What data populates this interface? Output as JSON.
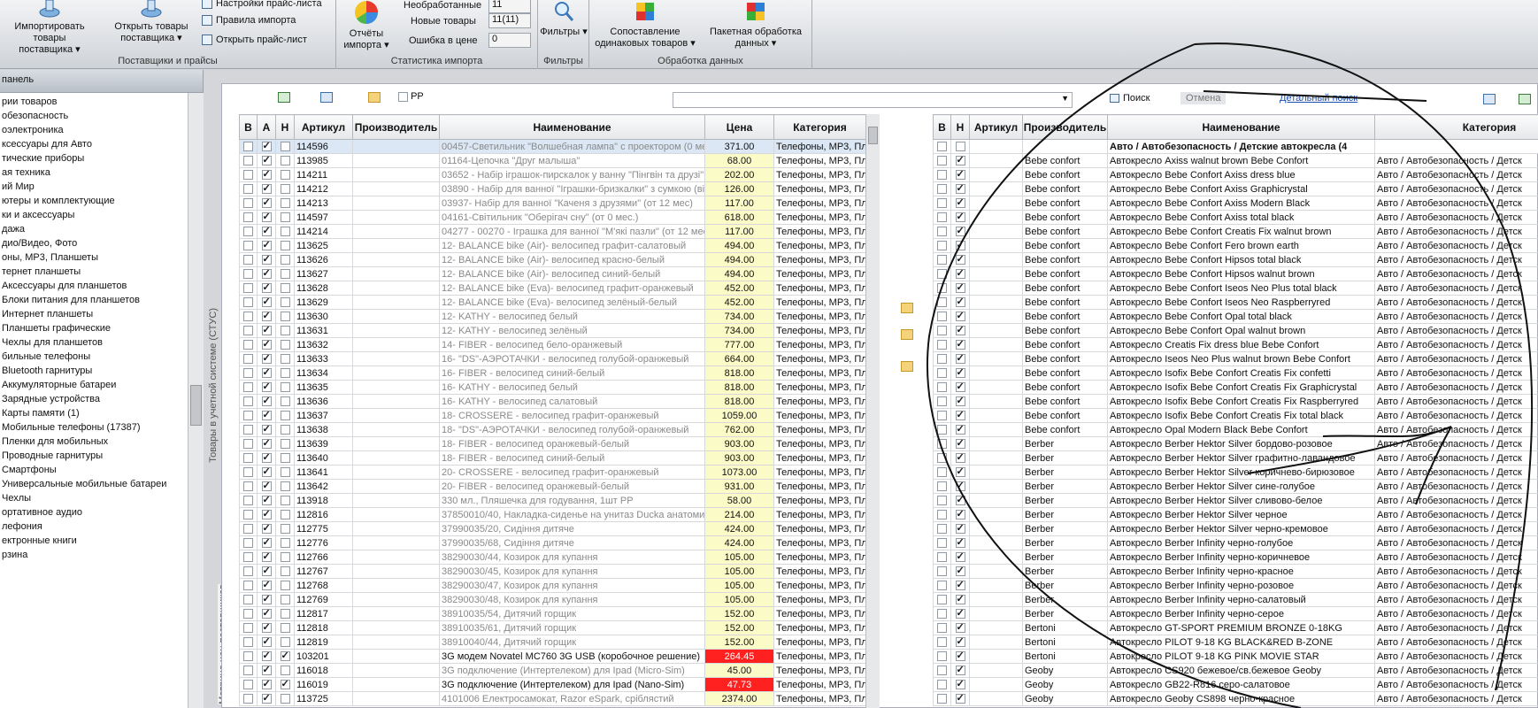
{
  "ribbon": {
    "suppliers": {
      "import_label": "Импортировать товары поставщика",
      "open_label": "Открыть товары поставщика",
      "settings_label": "Настройки прайс-листа",
      "rules_label": "Правила импорта",
      "open_price_label": "Открыть прайс-лист",
      "group_label": "Поставщики и прайсы"
    },
    "stats": {
      "reports_label": "Отчёты импорта",
      "unprocessed_label": "Необработанные",
      "unprocessed_value": "11",
      "new_label": "Новые товары",
      "new_value": "11(11)",
      "error_label": "Ошибка в цене",
      "error_value": "0",
      "group_label": "Статистика импорта"
    },
    "filters": {
      "label": "Фильтры",
      "group_label": "Фильтры"
    },
    "processing": {
      "match_label": "Сопоставление одинаковых товаров",
      "batch_label": "Пакетная обработка данных",
      "group_label": "Обработка данных"
    }
  },
  "left_panel": {
    "title": "панель",
    "tree_title": "рии товаров",
    "items": [
      "обезопасность",
      "оэлектроника",
      "ксессуары для Авто",
      "тические приборы",
      "ая техника",
      "ий Мир",
      "ютеры и комплектующие",
      "ки и аксессуары",
      "дажа",
      "дио/Видео, Фото",
      "оны, МР3, Планшеты",
      "тернет планшеты",
      "Аксессуары для планшетов",
      "Блоки питания для планшетов",
      "Интернет планшеты",
      "Планшеты графические",
      "Чехлы для планшетов",
      "бильные телефоны",
      "Bluetooth гарнитуры",
      "Аккумуляторные батареи",
      "Зарядные устройства",
      "Карты памяти (1)",
      "Мобильные телефоны (17387)",
      "Пленки для мобильных",
      "Проводные гарнитуры",
      "Смартфоны",
      "Универсальные мобильные батареи",
      "Чехлы",
      "ортативное аудио",
      "лефония",
      "ектронные книги",
      "рзина"
    ],
    "vertical_tab_1": "Товары в учетной системе (СТУС)",
    "vertical_tab_2": "Матрица цен поставщиков"
  },
  "toolbar": {
    "pp_label": "РР",
    "search_button": "Поиск",
    "cancel_button": "Отмена",
    "advanced_search": "Детальный поиск"
  },
  "left_grid": {
    "headers": [
      "В",
      "А",
      "Н",
      "Артикул",
      "Производитель",
      "Наименование",
      "Цена",
      "Категория"
    ],
    "rows": [
      {
        "v": false,
        "a": true,
        "n": false,
        "art": "114596",
        "name": "00457-Светильник \"Волшебная лампа\" с проектором (0 мес",
        "price": "371.00",
        "cat": "Телефоны, МР3, Пл",
        "sel": true
      },
      {
        "v": false,
        "a": true,
        "n": false,
        "art": "113985",
        "name": "01164-Цепочка \"Друг малыша\"",
        "price": "68.00",
        "cat": "Телефоны, МР3, Пл"
      },
      {
        "v": false,
        "a": true,
        "n": false,
        "art": "114211",
        "name": "03652 - Набір іграшок-пирскалок у ванну \"Пінгвін та друзі\"",
        "price": "202.00",
        "cat": "Телефоны, МР3, Пл"
      },
      {
        "v": false,
        "a": true,
        "n": false,
        "art": "114212",
        "name": "03890 - Набір для ванної \"Іграшки-бризкалки\" з сумкою (від",
        "price": "126.00",
        "cat": "Телефоны, МР3, Пл"
      },
      {
        "v": false,
        "a": true,
        "n": false,
        "art": "114213",
        "name": "03937- Набір для ванної \"Каченя з друзями\" (от 12 мес)",
        "price": "117.00",
        "cat": "Телефоны, МР3, Пл"
      },
      {
        "v": false,
        "a": true,
        "n": false,
        "art": "114597",
        "name": "04161-Світильник \"Оберігач сну\" (от 0 мес.)",
        "price": "618.00",
        "cat": "Телефоны, МР3, Пл"
      },
      {
        "v": false,
        "a": true,
        "n": false,
        "art": "114214",
        "name": "04277 - 00270 - Іграшка для ванної \"М'які пазли\" (от 12 мес",
        "price": "117.00",
        "cat": "Телефоны, МР3, Пл"
      },
      {
        "v": false,
        "a": true,
        "n": false,
        "art": "113625",
        "name": "12- BALANCE bike (Air)- велосипед графит-салатовый",
        "price": "494.00",
        "cat": "Телефоны, МР3, Пл"
      },
      {
        "v": false,
        "a": true,
        "n": false,
        "art": "113626",
        "name": "12- BALANCE bike (Air)- велосипед красно-белый",
        "price": "494.00",
        "cat": "Телефоны, МР3, Пл"
      },
      {
        "v": false,
        "a": true,
        "n": false,
        "art": "113627",
        "name": "12- BALANCE bike (Air)- велосипед синий-белый",
        "price": "494.00",
        "cat": "Телефоны, МР3, Пл"
      },
      {
        "v": false,
        "a": true,
        "n": false,
        "art": "113628",
        "name": "12- BALANCE bike (Eva)- велосипед графит-оранжевый",
        "price": "452.00",
        "cat": "Телефоны, МР3, Пл"
      },
      {
        "v": false,
        "a": true,
        "n": false,
        "art": "113629",
        "name": "12- BALANCE bike (Eva)- велосипед зелёный-белый",
        "price": "452.00",
        "cat": "Телефоны, МР3, Пл"
      },
      {
        "v": false,
        "a": true,
        "n": false,
        "art": "113630",
        "name": "12- KATHY - велосипед белый",
        "price": "734.00",
        "cat": "Телефоны, МР3, Пл"
      },
      {
        "v": false,
        "a": true,
        "n": false,
        "art": "113631",
        "name": "12- KATHY - велосипед зелёный",
        "price": "734.00",
        "cat": "Телефоны, МР3, Пл"
      },
      {
        "v": false,
        "a": true,
        "n": false,
        "art": "113632",
        "name": "14- FIBER - велосипед бело-оранжевый",
        "price": "777.00",
        "cat": "Телефоны, МР3, Пл"
      },
      {
        "v": false,
        "a": true,
        "n": false,
        "art": "113633",
        "name": "16- \"DS\"-АЭРОТАЧКИ - велосипед голубой-оранжевый",
        "price": "664.00",
        "cat": "Телефоны, МР3, Пл"
      },
      {
        "v": false,
        "a": true,
        "n": false,
        "art": "113634",
        "name": "16- FIBER - велосипед синий-белый",
        "price": "818.00",
        "cat": "Телефоны, МР3, Пл"
      },
      {
        "v": false,
        "a": true,
        "n": false,
        "art": "113635",
        "name": "16- KATHY - велосипед белый",
        "price": "818.00",
        "cat": "Телефоны, МР3, Пл"
      },
      {
        "v": false,
        "a": true,
        "n": false,
        "art": "113636",
        "name": "16- KATHY - велосипед салатовый",
        "price": "818.00",
        "cat": "Телефоны, МР3, Пл"
      },
      {
        "v": false,
        "a": true,
        "n": false,
        "art": "113637",
        "name": "18- CROSSERE - велосипед графит-оранжевый",
        "price": "1059.00",
        "cat": "Телефоны, МР3, Пл"
      },
      {
        "v": false,
        "a": true,
        "n": false,
        "art": "113638",
        "name": "18- \"DS\"-АЭРОТАЧКИ - велосипед голубой-оранжевый",
        "price": "762.00",
        "cat": "Телефоны, МР3, Пл"
      },
      {
        "v": false,
        "a": true,
        "n": false,
        "art": "113639",
        "name": "18- FIBER - велосипед оранжевый-белый",
        "price": "903.00",
        "cat": "Телефоны, МР3, Пл"
      },
      {
        "v": false,
        "a": true,
        "n": false,
        "art": "113640",
        "name": "18- FIBER - велосипед синий-белый",
        "price": "903.00",
        "cat": "Телефоны, МР3, Пл"
      },
      {
        "v": false,
        "a": true,
        "n": false,
        "art": "113641",
        "name": "20- CROSSERE - велосипед графит-оранжевый",
        "price": "1073.00",
        "cat": "Телефоны, МР3, Пл"
      },
      {
        "v": false,
        "a": true,
        "n": false,
        "art": "113642",
        "name": "20- FIBER - велосипед оранжевый-белый",
        "price": "931.00",
        "cat": "Телефоны, МР3, Пл"
      },
      {
        "v": false,
        "a": true,
        "n": false,
        "art": "113918",
        "name": "330 мл., Пляшечка для годування, 1шт РР",
        "price": "58.00",
        "cat": "Телефоны, МР3, Пл"
      },
      {
        "v": false,
        "a": true,
        "n": false,
        "art": "112816",
        "name": "37850010/40, Накладка-сиденье на унитаз Ducka анатоми",
        "price": "214.00",
        "cat": "Телефоны, МР3, Пл"
      },
      {
        "v": false,
        "a": true,
        "n": false,
        "art": "112775",
        "name": "37990035/20, Сидіння дитяче",
        "price": "424.00",
        "cat": "Телефоны, МР3, Пл"
      },
      {
        "v": false,
        "a": true,
        "n": false,
        "art": "112776",
        "name": "37990035/68, Сидіння дитяче",
        "price": "424.00",
        "cat": "Телефоны, МР3, Пл"
      },
      {
        "v": false,
        "a": true,
        "n": false,
        "art": "112766",
        "name": "38290030/44, Козирок для купання",
        "price": "105.00",
        "cat": "Телефоны, МР3, Пл"
      },
      {
        "v": false,
        "a": true,
        "n": false,
        "art": "112767",
        "name": "38290030/45, Козирок для купання",
        "price": "105.00",
        "cat": "Телефоны, МР3, Пл"
      },
      {
        "v": false,
        "a": true,
        "n": false,
        "art": "112768",
        "name": "38290030/47, Козирок для купання",
        "price": "105.00",
        "cat": "Телефоны, МР3, Пл"
      },
      {
        "v": false,
        "a": true,
        "n": false,
        "art": "112769",
        "name": "38290030/48, Козирок для купання",
        "price": "105.00",
        "cat": "Телефоны, МР3, Пл"
      },
      {
        "v": false,
        "a": true,
        "n": false,
        "art": "112817",
        "name": "38910035/54, Дитячий горщик",
        "price": "152.00",
        "cat": "Телефоны, МР3, Пл"
      },
      {
        "v": false,
        "a": true,
        "n": false,
        "art": "112818",
        "name": "38910035/61, Дитячий горщик",
        "price": "152.00",
        "cat": "Телефоны, МР3, Пл"
      },
      {
        "v": false,
        "a": true,
        "n": false,
        "art": "112819",
        "name": "38910040/44, Дитячий горщик",
        "price": "152.00",
        "cat": "Телефоны, МР3, Пл"
      },
      {
        "v": false,
        "a": true,
        "n": true,
        "art": "103201",
        "name": "3G модем Novatel MC760 3G USB (коробочное решение)",
        "price": "264.45",
        "cat": "Телефоны, МР3, Пл",
        "red": true,
        "black": true
      },
      {
        "v": false,
        "a": true,
        "n": false,
        "art": "116018",
        "name": "3G подключение (Интертелеком) для Ipad (Micro-Sim)",
        "price": "45.00",
        "cat": "Телефоны, МР3, Пл"
      },
      {
        "v": false,
        "a": true,
        "n": true,
        "art": "116019",
        "name": "3G подключение (Интертелеком) для Ipad (Nano-Sim)",
        "price": "47.73",
        "cat": "Телефоны, МР3, Пл",
        "red": true,
        "black": true
      },
      {
        "v": false,
        "a": true,
        "n": false,
        "art": "113725",
        "name": "4101006 Електросамокат, Razor eSpark, сріблястий",
        "price": "2374.00",
        "cat": "Телефоны, МР3, Пл"
      }
    ]
  },
  "right_grid": {
    "headers": [
      "В",
      "Н",
      "Артикул",
      "Производитель",
      "Наименование",
      "Категория"
    ],
    "group_row": "Авто / Автобезопасность / Детские автокресла (4",
    "rows": [
      {
        "maker": "Bebe confort",
        "name": "Автокресло Axiss walnut brown Bebe Confort",
        "cat": "Авто / Автобезопасность / Детск"
      },
      {
        "maker": "Bebe confort",
        "name": "Автокресло Bebe Confort Axiss dress blue",
        "cat": "Авто / Автобезопасность / Детск"
      },
      {
        "maker": "Bebe confort",
        "name": "Автокресло Bebe Confort Axiss Graphicrystal",
        "cat": "Авто / Автобезопасность / Детск"
      },
      {
        "maker": "Bebe confort",
        "name": "Автокресло Bebe Confort Axiss Modern Black",
        "cat": "Авто / Автобезопасность / Детск"
      },
      {
        "maker": "Bebe confort",
        "name": "Автокресло Bebe Confort Axiss total black",
        "cat": "Авто / Автобезопасность / Детск"
      },
      {
        "maker": "Bebe confort",
        "name": "Автокресло Bebe Confort Creatis Fix walnut brown",
        "cat": "Авто / Автобезопасность / Детск"
      },
      {
        "maker": "Bebe confort",
        "name": "Автокресло Bebe Confort Fero brown earth",
        "cat": "Авто / Автобезопасность / Детск"
      },
      {
        "maker": "Bebe confort",
        "name": "Автокресло Bebe Confort Hipsos total black",
        "cat": "Авто / Автобезопасность / Детск"
      },
      {
        "maker": "Bebe confort",
        "name": "Автокресло Bebe Confort Hipsos walnut brown",
        "cat": "Авто / Автобезопасность / Детск"
      },
      {
        "maker": "Bebe confort",
        "name": "Автокресло Bebe Confort Iseos Neo Plus total black",
        "cat": "Авто / Автобезопасность / Детск"
      },
      {
        "maker": "Bebe confort",
        "name": "Автокресло Bebe Confort Iseos Neo Raspberryred",
        "cat": "Авто / Автобезопасность / Детск"
      },
      {
        "maker": "Bebe confort",
        "name": "Автокресло Bebe Confort Opal total black",
        "cat": "Авто / Автобезопасность / Детск"
      },
      {
        "maker": "Bebe confort",
        "name": "Автокресло Bebe Confort Opal walnut brown",
        "cat": "Авто / Автобезопасность / Детск"
      },
      {
        "maker": "Bebe confort",
        "name": "Автокресло Creatis Fix dress blue Bebe Confort",
        "cat": "Авто / Автобезопасность / Детск"
      },
      {
        "maker": "Bebe confort",
        "name": "Автокресло Iseos Neo Plus walnut brown Bebe Confort",
        "cat": "Авто / Автобезопасность / Детск"
      },
      {
        "maker": "Bebe confort",
        "name": "Автокресло Isofix Bebe Confort Creatis Fix confetti",
        "cat": "Авто / Автобезопасность / Детск"
      },
      {
        "maker": "Bebe confort",
        "name": "Автокресло Isofix Bebe Confort Creatis Fix Graphicrystal",
        "cat": "Авто / Автобезопасность / Детск"
      },
      {
        "maker": "Bebe confort",
        "name": "Автокресло Isofix Bebe Confort Creatis Fix Raspberryred",
        "cat": "Авто / Автобезопасность / Детск"
      },
      {
        "maker": "Bebe confort",
        "name": "Автокресло Isofix Bebe Confort Creatis Fix total black",
        "cat": "Авто / Автобезопасность / Детск"
      },
      {
        "maker": "Bebe confort",
        "name": "Автокресло Opal Modern Black Bebe Confort",
        "cat": "Авто / Автобезопасность / Детск"
      },
      {
        "maker": "Berber",
        "name": "Автокресло Berber Hektor Silver бордово-розовое",
        "cat": "Авто / Автобезопасность / Детск"
      },
      {
        "maker": "Berber",
        "name": "Автокресло Berber Hektor Silver графитно-лавандовое",
        "cat": "Авто / Автобезопасность / Детск"
      },
      {
        "maker": "Berber",
        "name": "Автокресло Berber Hektor Silver коричнево-бирюзовое",
        "cat": "Авто / Автобезопасность / Детск"
      },
      {
        "maker": "Berber",
        "name": "Автокресло Berber Hektor Silver сине-голубое",
        "cat": "Авто / Автобезопасность / Детск"
      },
      {
        "maker": "Berber",
        "name": "Автокресло Berber Hektor Silver сливово-белое",
        "cat": "Авто / Автобезопасность / Детск"
      },
      {
        "maker": "Berber",
        "name": "Автокресло Berber Hektor Silver черное",
        "cat": "Авто / Автобезопасность / Детск"
      },
      {
        "maker": "Berber",
        "name": "Автокресло Berber Hektor Silver черно-кремовое",
        "cat": "Авто / Автобезопасность / Детск"
      },
      {
        "maker": "Berber",
        "name": "Автокресло Berber Infinity черно-голубое",
        "cat": "Авто / Автобезопасность / Детск"
      },
      {
        "maker": "Berber",
        "name": "Автокресло Berber Infinity черно-коричневое",
        "cat": "Авто / Автобезопасность / Детск"
      },
      {
        "maker": "Berber",
        "name": "Автокресло Berber Infinity черно-красное",
        "cat": "Авто / Автобезопасность / Детск"
      },
      {
        "maker": "Berber",
        "name": "Автокресло Berber Infinity черно-розовое",
        "cat": "Авто / Автобезопасность / Детск"
      },
      {
        "maker": "Berber",
        "name": "Автокресло Berber Infinity черно-салатовый",
        "cat": "Авто / Автобезопасность / Детск"
      },
      {
        "maker": "Berber",
        "name": "Автокресло Berber Infinity черно-серое",
        "cat": "Авто / Автобезопасность / Детск"
      },
      {
        "maker": "Bertoni",
        "name": "Автокресло GT-SPORT PREMIUM BRONZE 0-18KG",
        "cat": "Авто / Автобезопасность / Детск"
      },
      {
        "maker": "Bertoni",
        "name": "Автокресло PILOT 9-18 KG BLACK&RED B-ZONE",
        "cat": "Авто / Автобезопасность / Детск"
      },
      {
        "maker": "Bertoni",
        "name": "Автокресло PILOT 9-18 KG PINK MOVIE STAR",
        "cat": "Авто / Автобезопасность / Детск"
      },
      {
        "maker": "Geoby",
        "name": "Автокресло CS920 бежевое/св.бежевое Geoby",
        "cat": "Авто / Автобезопасность / Детск"
      },
      {
        "maker": "Geoby",
        "name": "Автокресло GB22-R816 серо-салатовое",
        "cat": "Авто / Автобезопасность / Детск"
      },
      {
        "maker": "Geoby",
        "name": "Автокресло Geoby CS898 черно-красное",
        "cat": "Авто / Автобезопасность / Детск"
      }
    ]
  },
  "colors": {
    "price_bg": "#fbfbc8",
    "price_error_bg": "#ff2020",
    "selected_row": "#dbe7f4"
  }
}
